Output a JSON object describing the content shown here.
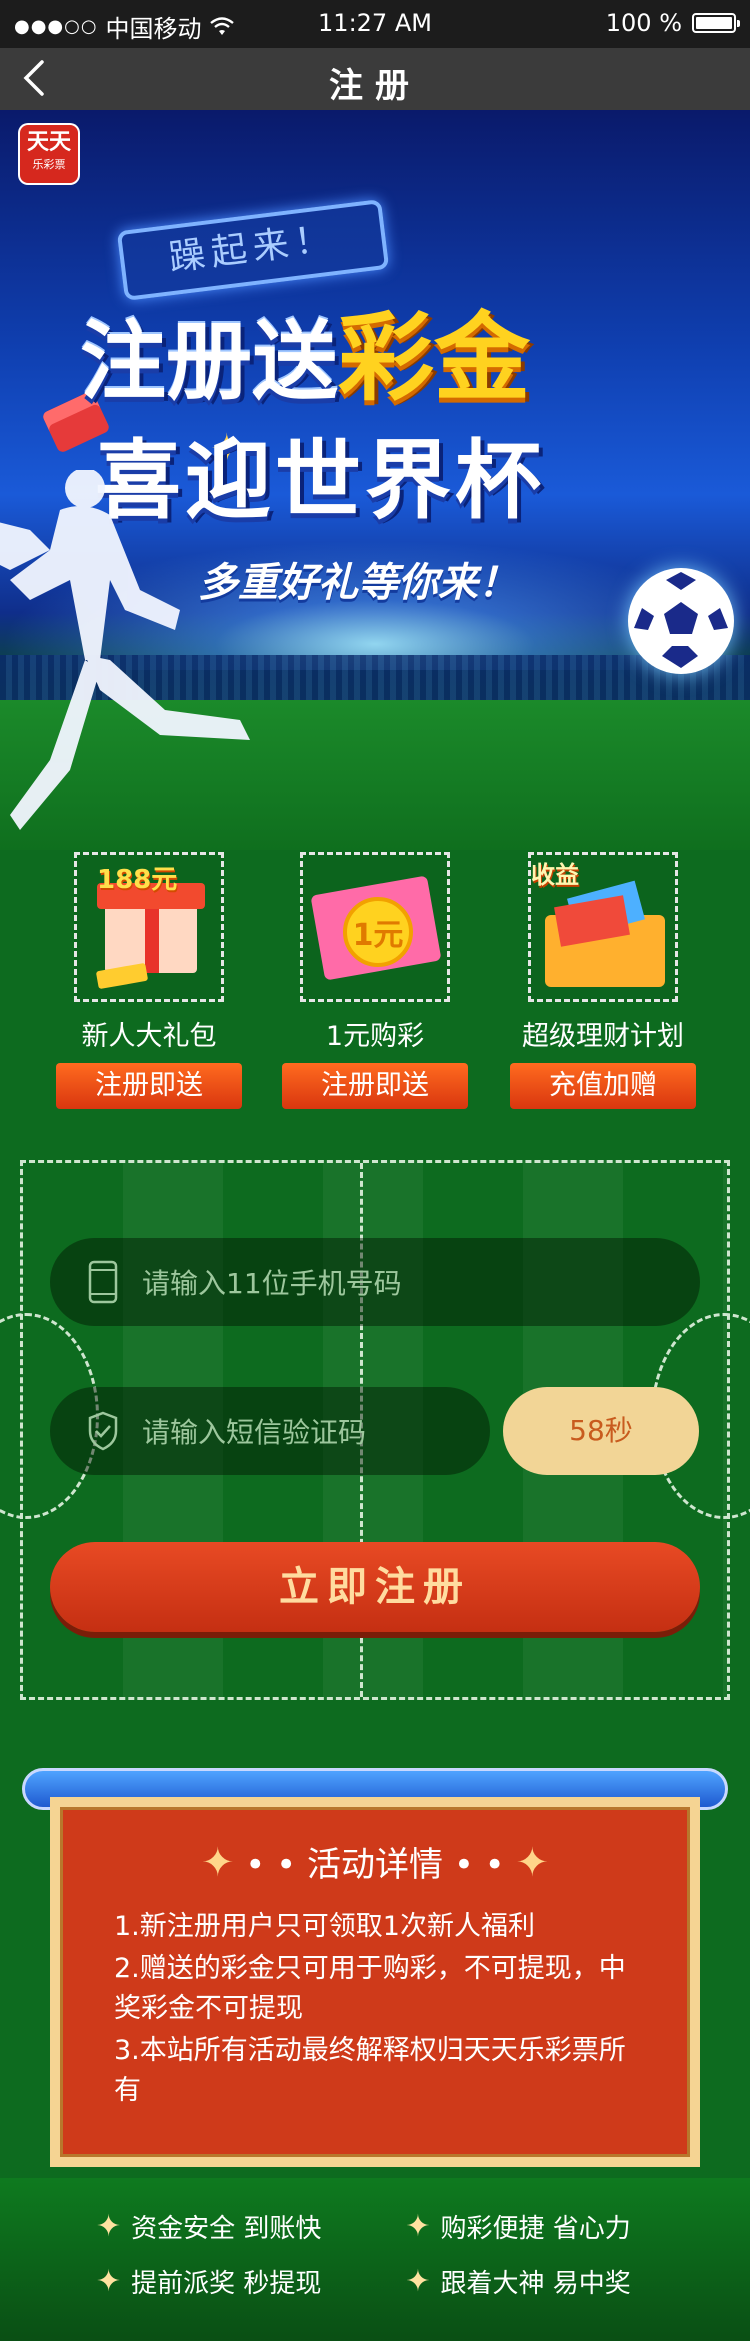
{
  "status_bar": {
    "carrier": "中国移动",
    "time": "11:27 AM",
    "battery": "100 %"
  },
  "nav": {
    "title": "注册"
  },
  "hero": {
    "logo_top": "天天",
    "logo_bottom": "乐彩票",
    "slogan": "躁起来！",
    "headline_white": "注册送",
    "headline_gold": "彩金",
    "headline2": "喜迎世界杯",
    "subline": "多重好礼等你来！"
  },
  "prizes": [
    {
      "badge": "188元",
      "label": "新人大礼包",
      "tag": "注册即送"
    },
    {
      "badge": "1元",
      "label": "1元购彩",
      "tag": "注册即送"
    },
    {
      "badge": "收益",
      "label": "超级理财计划",
      "tag": "充值加赠"
    }
  ],
  "form": {
    "phone_placeholder": "请输入11位手机号码",
    "code_placeholder": "请输入短信验证码",
    "countdown": "58秒",
    "register_button": "立即注册"
  },
  "details": {
    "title": "活动详情",
    "items": [
      "1.新注册用户只可领取1次新人福利",
      "2.赠送的彩金只可用于购彩，不可提现，中奖彩金不可提现",
      "3.本站所有活动最终解释权归天天乐彩票所有"
    ]
  },
  "footer": {
    "row1": [
      "资金安全  到账快",
      "购彩便捷  省心力"
    ],
    "row2": [
      "提前派奖  秒提现",
      "跟着大神  易中奖"
    ]
  }
}
